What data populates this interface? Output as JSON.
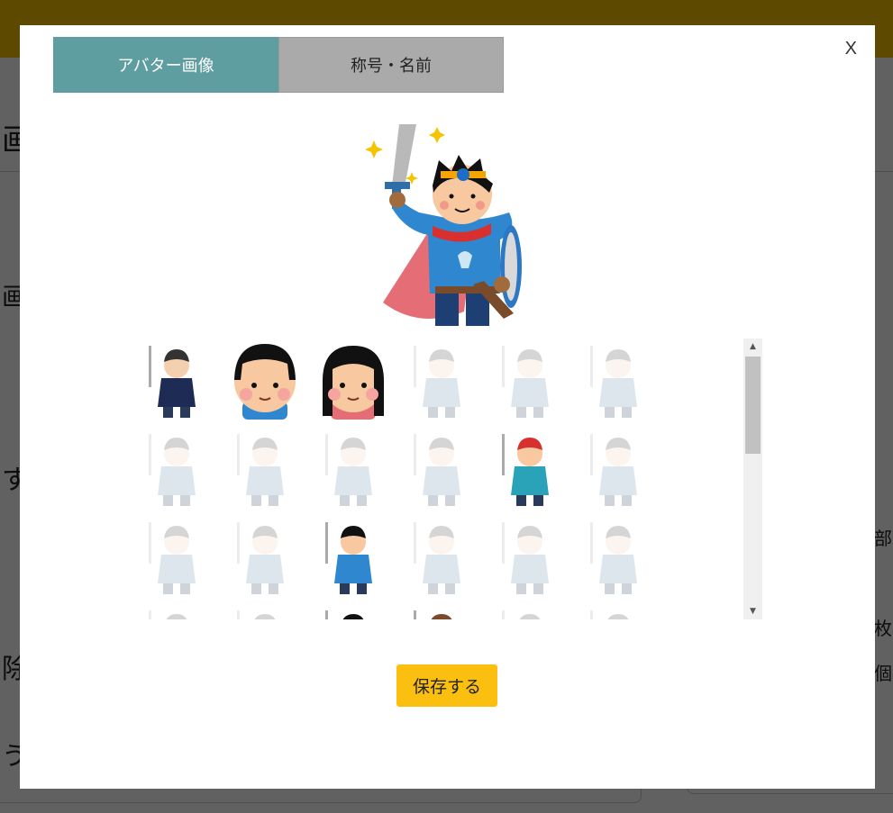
{
  "modal": {
    "close_label": "X",
    "tabs": [
      {
        "label": "アバター画像",
        "active": true
      },
      {
        "label": "称号・名前",
        "active": false
      }
    ],
    "save_label": "保存する"
  },
  "background_glyphs": [
    "画",
    "画",
    "す",
    "除",
    "う"
  ],
  "background_right_glyphs": [
    "部",
    "枚",
    "個"
  ],
  "colors": {
    "topbar": "#f5c000",
    "tab_active": "#5f9ea0",
    "tab_inactive": "#aaaaaa",
    "save_button": "#fbbf10"
  },
  "avatars": [
    {
      "icon": "pixel-hero-icon",
      "locked": false
    },
    {
      "icon": "boy-face-icon",
      "locked": false
    },
    {
      "icon": "girl-face-icon",
      "locked": false
    },
    {
      "icon": "salaryman-sprinting-icon",
      "locked": true
    },
    {
      "icon": "office-worker-desk-icon",
      "locked": true
    },
    {
      "icon": "certificate-holder-icon",
      "locked": true
    },
    {
      "icon": "ice-wizard-icon",
      "locked": true
    },
    {
      "icon": "forest-mage-icon",
      "locked": true
    },
    {
      "icon": "old-witch-icon",
      "locked": true
    },
    {
      "icon": "young-witch-icon",
      "locked": true
    },
    {
      "icon": "mermaid-icon",
      "locked": false
    },
    {
      "icon": "ninja-warrior-icon",
      "locked": true
    },
    {
      "icon": "professor-icon",
      "locked": true
    },
    {
      "icon": "dark-knight-icon",
      "locked": true
    },
    {
      "icon": "hero-icon",
      "locked": false
    },
    {
      "icon": "fire-mage-icon",
      "locked": true
    },
    {
      "icon": "magician-icon",
      "locked": true
    },
    {
      "icon": "ninja-icon",
      "locked": true
    },
    {
      "icon": "cat-icon",
      "locked": true
    },
    {
      "icon": "cat-icon",
      "locked": true
    },
    {
      "icon": "top-hat-icon",
      "locked": false
    },
    {
      "icon": "brown-hair-icon",
      "locked": false
    },
    {
      "icon": "pink-hair-icon",
      "locked": true
    },
    {
      "icon": "ghost-icon",
      "locked": true
    }
  ]
}
